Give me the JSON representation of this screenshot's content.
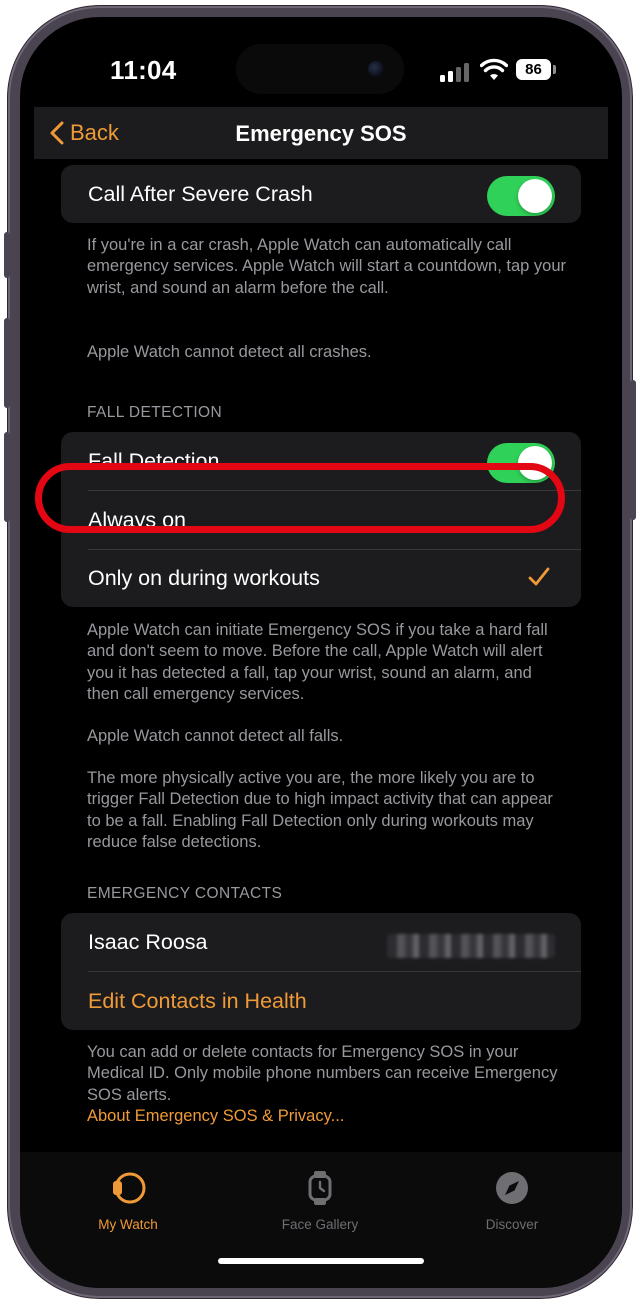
{
  "status_bar": {
    "time": "11:04",
    "battery": "86"
  },
  "nav": {
    "back_label": "Back",
    "title": "Emergency SOS"
  },
  "crash": {
    "toggle_label": "Call After Severe Crash",
    "toggle_on": true,
    "footer_1": "If you're in a car crash, Apple Watch can automatically call emergency services. Apple Watch will start a countdown, tap your wrist, and sound an alarm before the call.",
    "footer_2": "Apple Watch cannot detect all crashes."
  },
  "fall_detection": {
    "header": "FALL DETECTION",
    "toggle_label": "Fall Detection",
    "toggle_on": true,
    "options": [
      {
        "label": "Always on",
        "selected": false
      },
      {
        "label": "Only on during workouts",
        "selected": true
      }
    ],
    "footer_1": "Apple Watch can initiate Emergency SOS if you take a hard fall and don't seem to move. Before the call, Apple Watch will alert you it has detected a fall, tap your wrist, sound an alarm, and then call emergency services.",
    "footer_2": "Apple Watch cannot detect all falls.",
    "footer_3": "The more physically active you are, the more likely you are to trigger Fall Detection due to high impact activity that can appear to be a fall. Enabling Fall Detection only during workouts may reduce false detections."
  },
  "contacts": {
    "header": "EMERGENCY CONTACTS",
    "items": [
      {
        "name": "Isaac Roosa"
      }
    ],
    "edit_link": "Edit Contacts in Health",
    "footer": "You can add or delete contacts for Emergency SOS in your Medical ID. Only mobile phone numbers can receive Emergency SOS alerts.",
    "privacy_link": "About Emergency SOS & Privacy..."
  },
  "tab_bar": {
    "tabs": [
      {
        "label": "My Watch",
        "icon": "watch-icon",
        "active": true
      },
      {
        "label": "Face Gallery",
        "icon": "watch-face-icon",
        "active": false
      },
      {
        "label": "Discover",
        "icon": "compass-icon",
        "active": false
      }
    ]
  },
  "colors": {
    "accent": "#f09a37",
    "toggle_on": "#30d158",
    "annotation_ring": "#e30613",
    "cell_background": "#1c1c1e",
    "secondary_text": "#98989e"
  }
}
